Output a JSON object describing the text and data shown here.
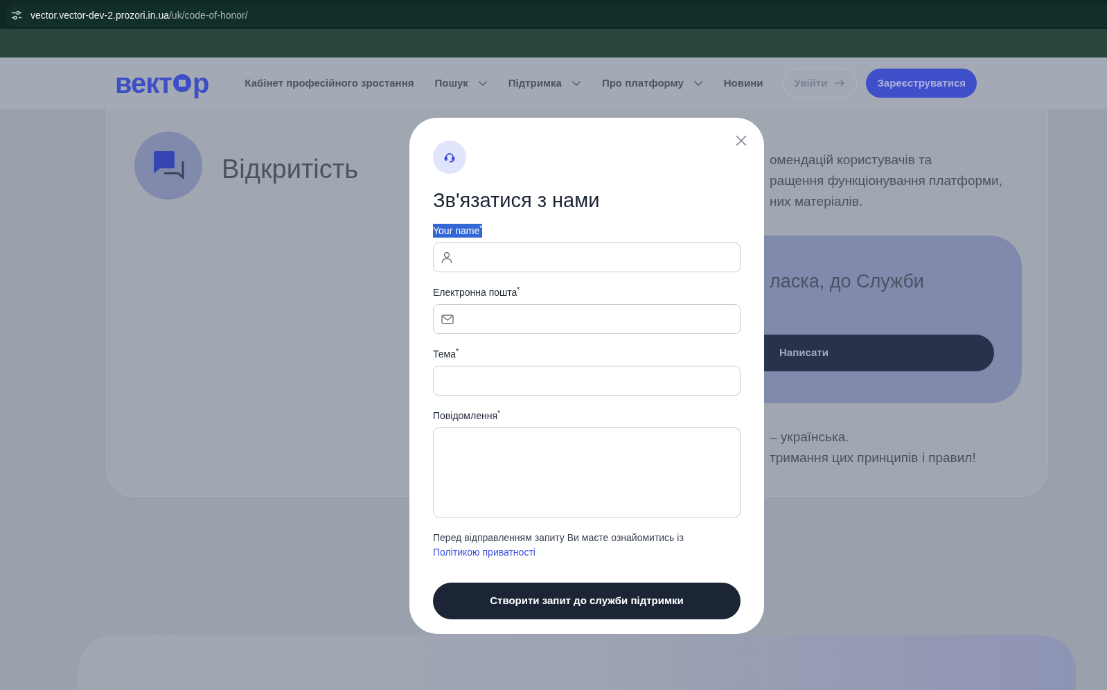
{
  "browser": {
    "url_host": "vector.vector-dev-2.prozori.in.ua",
    "url_path": "/uk/code-of-honor/"
  },
  "header": {
    "logo": [
      "вект",
      "р"
    ],
    "nav": [
      {
        "label": "Кабінет професійного зростання",
        "kind": "link"
      },
      {
        "label": "Пошук",
        "kind": "dropdown"
      },
      {
        "label": "Підтримка",
        "kind": "dropdown"
      },
      {
        "label": "Про платформу",
        "kind": "dropdown"
      },
      {
        "label": "Новини",
        "kind": "link"
      }
    ],
    "buttons": [
      {
        "label": "Увійти",
        "kind": "outline"
      },
      {
        "label": "Зареєструватися",
        "kind": "primary"
      }
    ]
  },
  "page": {
    "section_title": "Відкритість",
    "text_top": [
      "омендацій користувачів та",
      "ращення функціонування платформи,",
      "них матеріалів."
    ],
    "panel_title": "ласка, до Служби",
    "panel_button": "Написати",
    "text_bottom": [
      "– українська.",
      "тримання цих принципів і правил!"
    ]
  },
  "modal": {
    "title": "Зв'язатися з нами",
    "fields": [
      {
        "label": "Your name$^{*}$",
        "kind": "name",
        "text_selected": true
      },
      {
        "label": "Електронна пошта$^{*}$",
        "kind": "email",
        "text_selected": false
      },
      {
        "label": "Тема$^{*}$",
        "kind": "text",
        "text_selected": false
      },
      {
        "label": "Повідомлення$^{*}$",
        "kind": "textarea",
        "text_selected": false
      }
    ],
    "notice": "Перед відправленням запиту Ви маєте ознайомитись із",
    "notice_link": "Політикою приватності",
    "submit": "Створити запит до служби підтримки"
  }
}
